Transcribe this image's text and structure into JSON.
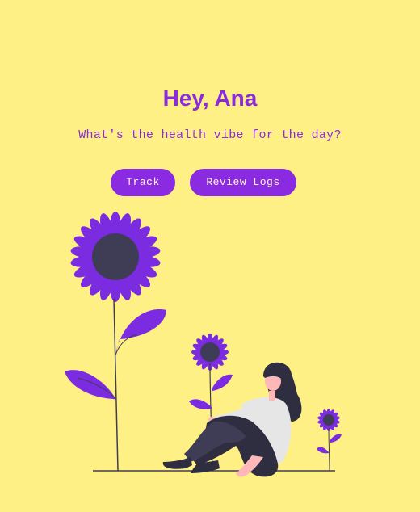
{
  "header": {
    "greeting": "Hey, Ana",
    "subtitle": "What's the health vibe for the day?"
  },
  "actions": {
    "track_label": "Track",
    "review_label": "Review Logs"
  },
  "colors": {
    "background": "#FFF085",
    "accent": "#8A2BE2",
    "button_text": "#FFF8D6",
    "flower_center": "#3F3D56"
  },
  "illustration": {
    "icon": "woman-sitting-with-sunflowers"
  }
}
